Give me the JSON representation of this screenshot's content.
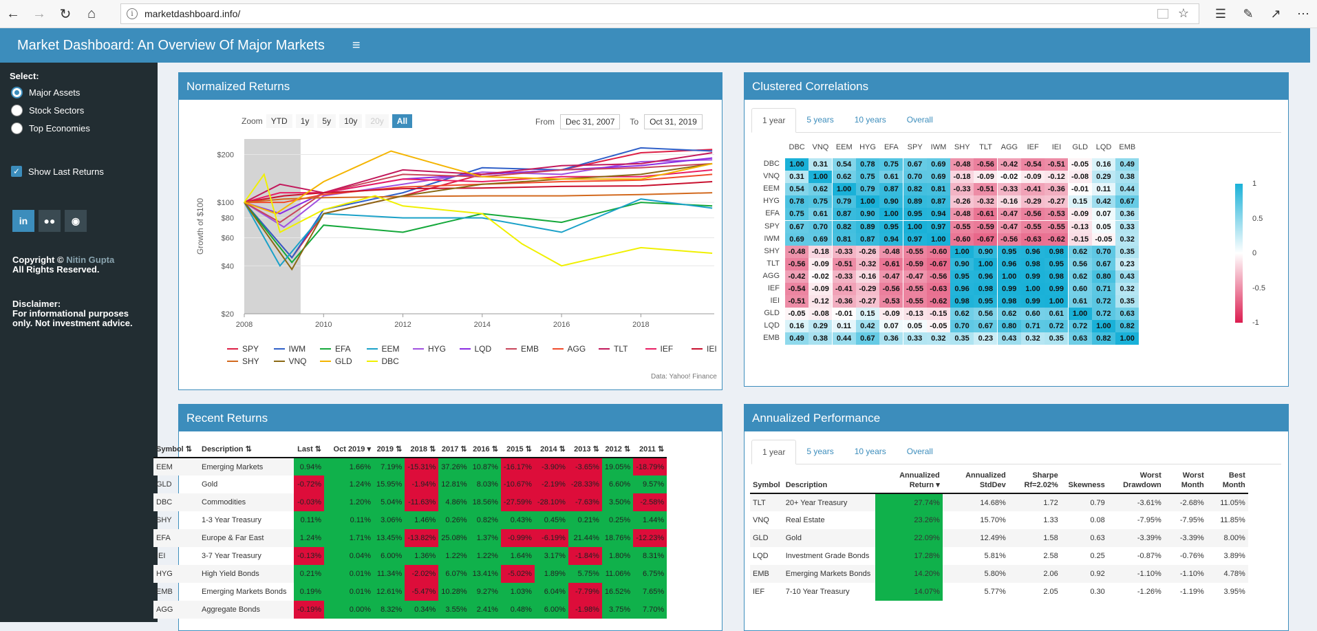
{
  "browser": {
    "url": "marketdashboard.info/"
  },
  "header": {
    "title": "Market Dashboard: An Overview Of Major Markets",
    "menu": "≡"
  },
  "sidebar": {
    "select_label": "Select:",
    "options": [
      "Major Assets",
      "Stock Sectors",
      "Top Economies"
    ],
    "selected": 0,
    "show_last": "Show Last Returns",
    "copyright": "Copyright © ",
    "author": "Nitin Gupta",
    "rights": "All Rights Reserved.",
    "disclaimer_title": "Disclaimer:",
    "disclaimer_l1": "For informational purposes",
    "disclaimer_l2": "only. Not investment advice."
  },
  "normalized": {
    "title": "Normalized Returns",
    "zoom_label": "Zoom",
    "zoom_buttons": [
      "YTD",
      "1y",
      "5y",
      "10y",
      "20y",
      "All"
    ],
    "from_label": "From",
    "from": "Dec 31, 2007",
    "to_label": "To",
    "to": "Oct 31, 2019",
    "source": "Data: Yahoo! Finance"
  },
  "chart_data": {
    "type": "line",
    "ylabel": "Growth of $100",
    "y_ticks": [
      "$200",
      "$100",
      "$80",
      "$60",
      "$40",
      "$20"
    ],
    "x_ticks": [
      "2008",
      "2010",
      "2012",
      "2014",
      "2016",
      "2018"
    ],
    "ylim": [
      20,
      250
    ],
    "log_scale": true,
    "series": [
      {
        "name": "SPY",
        "color": "#dd1e45",
        "points": [
          [
            2008,
            100
          ],
          [
            2009.2,
            45
          ],
          [
            2010,
            85
          ],
          [
            2012,
            110
          ],
          [
            2014,
            150
          ],
          [
            2016,
            160
          ],
          [
            2018,
            205
          ],
          [
            2019.8,
            215
          ]
        ]
      },
      {
        "name": "IWM",
        "color": "#2f5fc8",
        "points": [
          [
            2008,
            100
          ],
          [
            2009.2,
            45
          ],
          [
            2010,
            90
          ],
          [
            2012,
            115
          ],
          [
            2014,
            165
          ],
          [
            2016,
            160
          ],
          [
            2018,
            220
          ],
          [
            2019.8,
            210
          ]
        ]
      },
      {
        "name": "EFA",
        "color": "#14a83a",
        "points": [
          [
            2008,
            100
          ],
          [
            2009.2,
            42
          ],
          [
            2010,
            72
          ],
          [
            2012,
            65
          ],
          [
            2014,
            85
          ],
          [
            2016,
            75
          ],
          [
            2018,
            100
          ],
          [
            2019.8,
            95
          ]
        ]
      },
      {
        "name": "EEM",
        "color": "#1aa1c8",
        "points": [
          [
            2008,
            100
          ],
          [
            2008.9,
            40
          ],
          [
            2010,
            85
          ],
          [
            2012,
            80
          ],
          [
            2014,
            80
          ],
          [
            2016,
            65
          ],
          [
            2018,
            105
          ],
          [
            2019.8,
            92
          ]
        ]
      },
      {
        "name": "HYG",
        "color": "#a050e0",
        "points": [
          [
            2008,
            100
          ],
          [
            2009,
            70
          ],
          [
            2010,
            110
          ],
          [
            2012,
            130
          ],
          [
            2014,
            155
          ],
          [
            2016,
            150
          ],
          [
            2018,
            180
          ],
          [
            2019.8,
            185
          ]
        ]
      },
      {
        "name": "LQD",
        "color": "#8a2be2",
        "points": [
          [
            2008,
            100
          ],
          [
            2008.9,
            85
          ],
          [
            2010,
            115
          ],
          [
            2012,
            140
          ],
          [
            2014,
            150
          ],
          [
            2016,
            160
          ],
          [
            2018,
            170
          ],
          [
            2019.8,
            190
          ]
        ]
      },
      {
        "name": "EMB",
        "color": "#c8445a",
        "points": [
          [
            2008,
            100
          ],
          [
            2008.9,
            75
          ],
          [
            2010,
            115
          ],
          [
            2012,
            150
          ],
          [
            2014,
            145
          ],
          [
            2016,
            160
          ],
          [
            2018,
            165
          ],
          [
            2019.8,
            175
          ]
        ]
      },
      {
        "name": "AGG",
        "color": "#f04a2a",
        "points": [
          [
            2008,
            100
          ],
          [
            2009,
            100
          ],
          [
            2010,
            112
          ],
          [
            2012,
            125
          ],
          [
            2014,
            130
          ],
          [
            2016,
            135
          ],
          [
            2018,
            138
          ],
          [
            2019.8,
            150
          ]
        ]
      },
      {
        "name": "TLT",
        "color": "#c2185b",
        "points": [
          [
            2008,
            100
          ],
          [
            2008.9,
            130
          ],
          [
            2010,
            115
          ],
          [
            2012,
            160
          ],
          [
            2014,
            150
          ],
          [
            2016,
            170
          ],
          [
            2018,
            175
          ],
          [
            2019.8,
            205
          ]
        ]
      },
      {
        "name": "IEF",
        "color": "#e91e63",
        "points": [
          [
            2008,
            100
          ],
          [
            2008.9,
            115
          ],
          [
            2010,
            115
          ],
          [
            2012,
            140
          ],
          [
            2014,
            135
          ],
          [
            2016,
            145
          ],
          [
            2018,
            145
          ],
          [
            2019.8,
            160
          ]
        ]
      },
      {
        "name": "IEI",
        "color": "#c8102e",
        "points": [
          [
            2008,
            100
          ],
          [
            2009,
            110
          ],
          [
            2010,
            115
          ],
          [
            2012,
            122
          ],
          [
            2014,
            123
          ],
          [
            2016,
            126
          ],
          [
            2018,
            127
          ],
          [
            2019.8,
            135
          ]
        ]
      },
      {
        "name": "SHY",
        "color": "#d2691e",
        "points": [
          [
            2008,
            100
          ],
          [
            2009,
            105
          ],
          [
            2010,
            107
          ],
          [
            2012,
            109
          ],
          [
            2014,
            110
          ],
          [
            2016,
            110
          ],
          [
            2018,
            112
          ],
          [
            2019.8,
            115
          ]
        ]
      },
      {
        "name": "VNQ",
        "color": "#8b6914",
        "points": [
          [
            2008,
            100
          ],
          [
            2009.2,
            38
          ],
          [
            2010,
            85
          ],
          [
            2012,
            110
          ],
          [
            2014,
            130
          ],
          [
            2016,
            140
          ],
          [
            2018,
            150
          ],
          [
            2019.8,
            175
          ]
        ]
      },
      {
        "name": "GLD",
        "color": "#f4b400",
        "points": [
          [
            2008,
            100
          ],
          [
            2008.8,
            85
          ],
          [
            2010,
            135
          ],
          [
            2011.7,
            210
          ],
          [
            2013,
            170
          ],
          [
            2014,
            145
          ],
          [
            2016,
            140
          ],
          [
            2018,
            140
          ],
          [
            2019.8,
            175
          ]
        ]
      },
      {
        "name": "DBC",
        "color": "#f0f000",
        "points": [
          [
            2008,
            100
          ],
          [
            2008.5,
            150
          ],
          [
            2008.9,
            65
          ],
          [
            2010,
            90
          ],
          [
            2011.3,
            110
          ],
          [
            2012,
            95
          ],
          [
            2014,
            85
          ],
          [
            2015,
            55
          ],
          [
            2016,
            40
          ],
          [
            2018,
            52
          ],
          [
            2019.8,
            48
          ]
        ]
      }
    ]
  },
  "correlations": {
    "title": "Clustered Correlations",
    "tabs": [
      "1 year",
      "5 years",
      "10 years",
      "Overall"
    ],
    "active_tab": 0,
    "labels": [
      "DBC",
      "VNQ",
      "EEM",
      "HYG",
      "EFA",
      "SPY",
      "IWM",
      "SHY",
      "TLT",
      "AGG",
      "IEF",
      "IEI",
      "GLD",
      "LQD",
      "EMB"
    ],
    "matrix": [
      [
        "1.00",
        "0.31",
        "0.54",
        "0.78",
        "0.75",
        "0.67",
        "0.69",
        "-0.48",
        "-0.56",
        "-0.42",
        "-0.54",
        "-0.51",
        "-0.05",
        "0.16",
        "0.49"
      ],
      [
        "0.31",
        "1.00",
        "0.62",
        "0.75",
        "0.61",
        "0.70",
        "0.69",
        "-0.18",
        "-0.09",
        "-0.02",
        "-0.09",
        "-0.12",
        "-0.08",
        "0.29",
        "0.38"
      ],
      [
        "0.54",
        "0.62",
        "1.00",
        "0.79",
        "0.87",
        "0.82",
        "0.81",
        "-0.33",
        "-0.51",
        "-0.33",
        "-0.41",
        "-0.36",
        "-0.01",
        "0.11",
        "0.44"
      ],
      [
        "0.78",
        "0.75",
        "0.79",
        "1.00",
        "0.90",
        "0.89",
        "0.87",
        "-0.26",
        "-0.32",
        "-0.16",
        "-0.29",
        "-0.27",
        "0.15",
        "0.42",
        "0.67"
      ],
      [
        "0.75",
        "0.61",
        "0.87",
        "0.90",
        "1.00",
        "0.95",
        "0.94",
        "-0.48",
        "-0.61",
        "-0.47",
        "-0.56",
        "-0.53",
        "-0.09",
        "0.07",
        "0.36"
      ],
      [
        "0.67",
        "0.70",
        "0.82",
        "0.89",
        "0.95",
        "1.00",
        "0.97",
        "-0.55",
        "-0.59",
        "-0.47",
        "-0.55",
        "-0.55",
        "-0.13",
        "0.05",
        "0.33"
      ],
      [
        "0.69",
        "0.69",
        "0.81",
        "0.87",
        "0.94",
        "0.97",
        "1.00",
        "-0.60",
        "-0.67",
        "-0.56",
        "-0.63",
        "-0.62",
        "-0.15",
        "-0.05",
        "0.32"
      ],
      [
        "-0.48",
        "-0.18",
        "-0.33",
        "-0.26",
        "-0.48",
        "-0.55",
        "-0.60",
        "1.00",
        "0.90",
        "0.95",
        "0.96",
        "0.98",
        "0.62",
        "0.70",
        "0.35"
      ],
      [
        "-0.56",
        "-0.09",
        "-0.51",
        "-0.32",
        "-0.61",
        "-0.59",
        "-0.67",
        "0.90",
        "1.00",
        "0.96",
        "0.98",
        "0.95",
        "0.56",
        "0.67",
        "0.23"
      ],
      [
        "-0.42",
        "-0.02",
        "-0.33",
        "-0.16",
        "-0.47",
        "-0.47",
        "-0.56",
        "0.95",
        "0.96",
        "1.00",
        "0.99",
        "0.98",
        "0.62",
        "0.80",
        "0.43"
      ],
      [
        "-0.54",
        "-0.09",
        "-0.41",
        "-0.29",
        "-0.56",
        "-0.55",
        "-0.63",
        "0.96",
        "0.98",
        "0.99",
        "1.00",
        "0.99",
        "0.60",
        "0.71",
        "0.32"
      ],
      [
        "-0.51",
        "-0.12",
        "-0.36",
        "-0.27",
        "-0.53",
        "-0.55",
        "-0.62",
        "0.98",
        "0.95",
        "0.98",
        "0.99",
        "1.00",
        "0.61",
        "0.72",
        "0.35"
      ],
      [
        "-0.05",
        "-0.08",
        "-0.01",
        "0.15",
        "-0.09",
        "-0.13",
        "-0.15",
        "0.62",
        "0.56",
        "0.62",
        "0.60",
        "0.61",
        "1.00",
        "0.72",
        "0.63"
      ],
      [
        "0.16",
        "0.29",
        "0.11",
        "0.42",
        "0.07",
        "0.05",
        "-0.05",
        "0.70",
        "0.67",
        "0.80",
        "0.71",
        "0.72",
        "0.72",
        "1.00",
        "0.82"
      ],
      [
        "0.49",
        "0.38",
        "0.44",
        "0.67",
        "0.36",
        "0.33",
        "0.32",
        "0.35",
        "0.23",
        "0.43",
        "0.32",
        "0.35",
        "0.63",
        "0.82",
        "1.00"
      ]
    ],
    "scale_labels": [
      "1",
      "0.5",
      "0",
      "-0.5",
      "-1"
    ],
    "color_pos": "#1ab1d8",
    "color_neg": "#dc1d50"
  },
  "recent": {
    "title": "Recent Returns",
    "columns": [
      "Symbol",
      "Description",
      "Last",
      "Oct 2019",
      "2019",
      "2018",
      "2017",
      "2016",
      "2015",
      "2014",
      "2013",
      "2012",
      "2011"
    ],
    "rows": [
      [
        "EEM",
        "Emerging Markets",
        "0.94%",
        "1.66%",
        "7.19%",
        "-15.31%",
        "37.26%",
        "10.87%",
        "-16.17%",
        "-3.90%",
        "-3.65%",
        "19.05%",
        "-18.79%"
      ],
      [
        "GLD",
        "Gold",
        "-0.72%",
        "1.24%",
        "15.95%",
        "-1.94%",
        "12.81%",
        "8.03%",
        "-10.67%",
        "-2.19%",
        "-28.33%",
        "6.60%",
        "9.57%"
      ],
      [
        "DBC",
        "Commodities",
        "-0.03%",
        "1.20%",
        "5.04%",
        "-11.63%",
        "4.86%",
        "18.56%",
        "-27.59%",
        "-28.10%",
        "-7.63%",
        "3.50%",
        "-2.58%"
      ],
      [
        "SHY",
        "1-3 Year Treasury",
        "0.11%",
        "0.11%",
        "3.06%",
        "1.46%",
        "0.26%",
        "0.82%",
        "0.43%",
        "0.45%",
        "0.21%",
        "0.25%",
        "1.44%"
      ],
      [
        "EFA",
        "Europe & Far East",
        "1.24%",
        "1.71%",
        "13.45%",
        "-13.82%",
        "25.08%",
        "1.37%",
        "-0.99%",
        "-6.19%",
        "21.44%",
        "18.76%",
        "-12.23%"
      ],
      [
        "IEI",
        "3-7 Year Treasury",
        "-0.13%",
        "0.04%",
        "6.00%",
        "1.36%",
        "1.22%",
        "1.22%",
        "1.64%",
        "3.17%",
        "-1.84%",
        "1.80%",
        "8.31%"
      ],
      [
        "HYG",
        "High Yield Bonds",
        "0.21%",
        "0.01%",
        "11.34%",
        "-2.02%",
        "6.07%",
        "13.41%",
        "-5.02%",
        "1.89%",
        "5.75%",
        "11.06%",
        "6.75%"
      ],
      [
        "EMB",
        "Emerging Markets Bonds",
        "0.19%",
        "0.01%",
        "12.61%",
        "-5.47%",
        "10.28%",
        "9.27%",
        "1.03%",
        "6.04%",
        "-7.79%",
        "16.52%",
        "7.65%"
      ],
      [
        "AGG",
        "Aggregate Bonds",
        "-0.19%",
        "0.00%",
        "8.32%",
        "0.34%",
        "3.55%",
        "2.41%",
        "0.48%",
        "6.00%",
        "-1.98%",
        "3.75%",
        "7.70%"
      ]
    ]
  },
  "annual": {
    "title": "Annualized Performance",
    "tabs": [
      "1 year",
      "5 years",
      "10 years",
      "Overall"
    ],
    "active_tab": 0,
    "columns": [
      "Symbol",
      "Description",
      "Annualized Return",
      "Annualized StdDev",
      "Sharpe Rf=2.02%",
      "Skewness",
      "Worst Drawdown",
      "Worst Month",
      "Best Month"
    ],
    "rows": [
      [
        "TLT",
        "20+ Year Treasury",
        "27.74%",
        "14.68%",
        "1.72",
        "0.79",
        "-3.61%",
        "-2.68%",
        "11.05%"
      ],
      [
        "VNQ",
        "Real Estate",
        "23.26%",
        "15.70%",
        "1.33",
        "0.08",
        "-7.95%",
        "-7.95%",
        "11.85%"
      ],
      [
        "GLD",
        "Gold",
        "22.09%",
        "12.49%",
        "1.58",
        "0.63",
        "-3.39%",
        "-3.39%",
        "8.00%"
      ],
      [
        "LQD",
        "Investment Grade Bonds",
        "17.28%",
        "5.81%",
        "2.58",
        "0.25",
        "-0.87%",
        "-0.76%",
        "3.89%"
      ],
      [
        "EMB",
        "Emerging Markets Bonds",
        "14.20%",
        "5.80%",
        "2.06",
        "0.92",
        "-1.10%",
        "-1.10%",
        "4.78%"
      ],
      [
        "IEF",
        "7-10 Year Treasury",
        "14.07%",
        "5.77%",
        "2.05",
        "0.30",
        "-1.26%",
        "-1.19%",
        "3.95%"
      ]
    ]
  }
}
